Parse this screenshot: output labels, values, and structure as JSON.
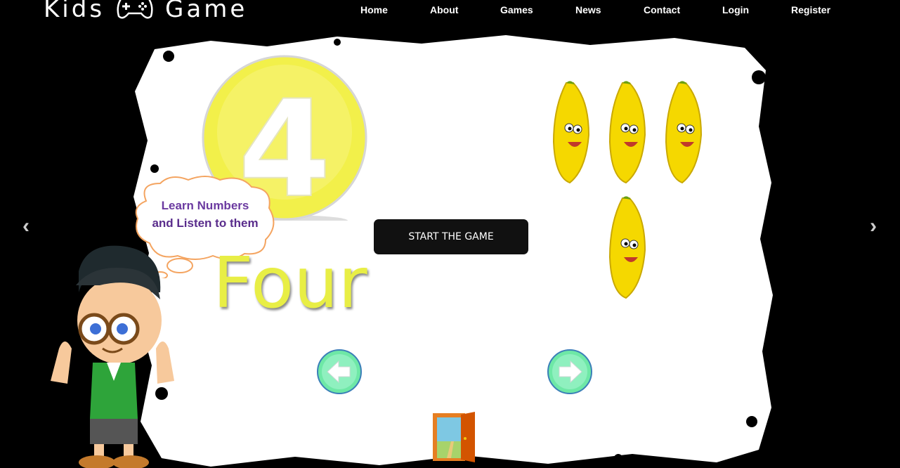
{
  "brand": {
    "name_left": "Kids",
    "name_right": "Game",
    "logo_icon": "gamepad-icon"
  },
  "nav": {
    "items": [
      "Home",
      "About",
      "Games",
      "News",
      "Contact",
      "Login",
      "Register"
    ]
  },
  "slide": {
    "number": "4",
    "word": "Four",
    "bubble_line1": "Learn Numbers",
    "bubble_line2": "and Listen to them",
    "start_button": "START THE GAME",
    "banana_count": 4
  },
  "carousel": {
    "prev": "‹",
    "next": "›"
  },
  "colors": {
    "number_ball": "#f2f04a",
    "word": "#e8ee45",
    "button_bg": "#111111",
    "arrow_btn": "#6ee8a6"
  }
}
